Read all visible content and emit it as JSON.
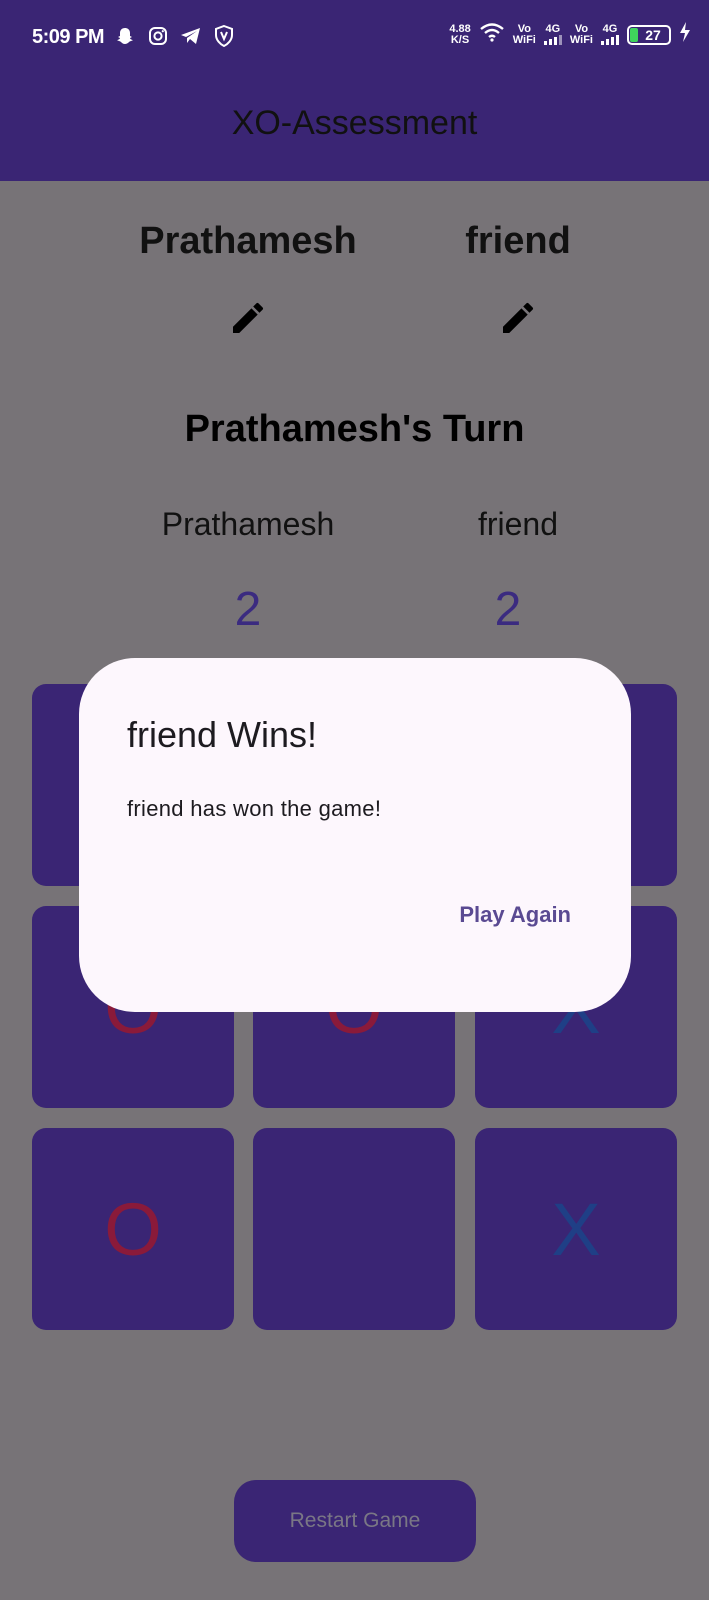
{
  "status_bar": {
    "time": "5:09 PM",
    "net_speed": "4.88",
    "net_speed_unit": "K/S",
    "sim1_label_top": "Vo",
    "sim1_label_bottom": "WiFi",
    "sim1_network": "4G",
    "sim2_label_top": "Vo",
    "sim2_label_bottom": "WiFi",
    "sim2_network": "4G",
    "battery": "27",
    "icons": [
      "snapchat-icon",
      "instagram-icon",
      "telegram-icon",
      "vpn-icon",
      "wifi-icon",
      "charging-icon"
    ]
  },
  "app_bar": {
    "title": "XO-Assessment"
  },
  "players": {
    "player1": "Prathamesh",
    "player2": "friend"
  },
  "turn_text": "Prathamesh's Turn",
  "scoreboard": {
    "player1_name": "Prathamesh",
    "player2_name": "friend",
    "player1_score": "2",
    "player2_score": "2"
  },
  "board": [
    "",
    "",
    "",
    "O",
    "O",
    "X",
    "O",
    "",
    "X"
  ],
  "restart_label": "Restart Game",
  "dialog": {
    "title": "friend Wins!",
    "message": "friend has won the game!",
    "action_label": "Play Again"
  },
  "colors": {
    "app_bar": "#3a2574",
    "scrim_background": "#777377",
    "cell": "#3a2574",
    "mark_o": "#8a1a3a",
    "mark_x": "#1f3f86",
    "dialog_bg": "#fdf7fd",
    "accent": "#5a4a92"
  }
}
